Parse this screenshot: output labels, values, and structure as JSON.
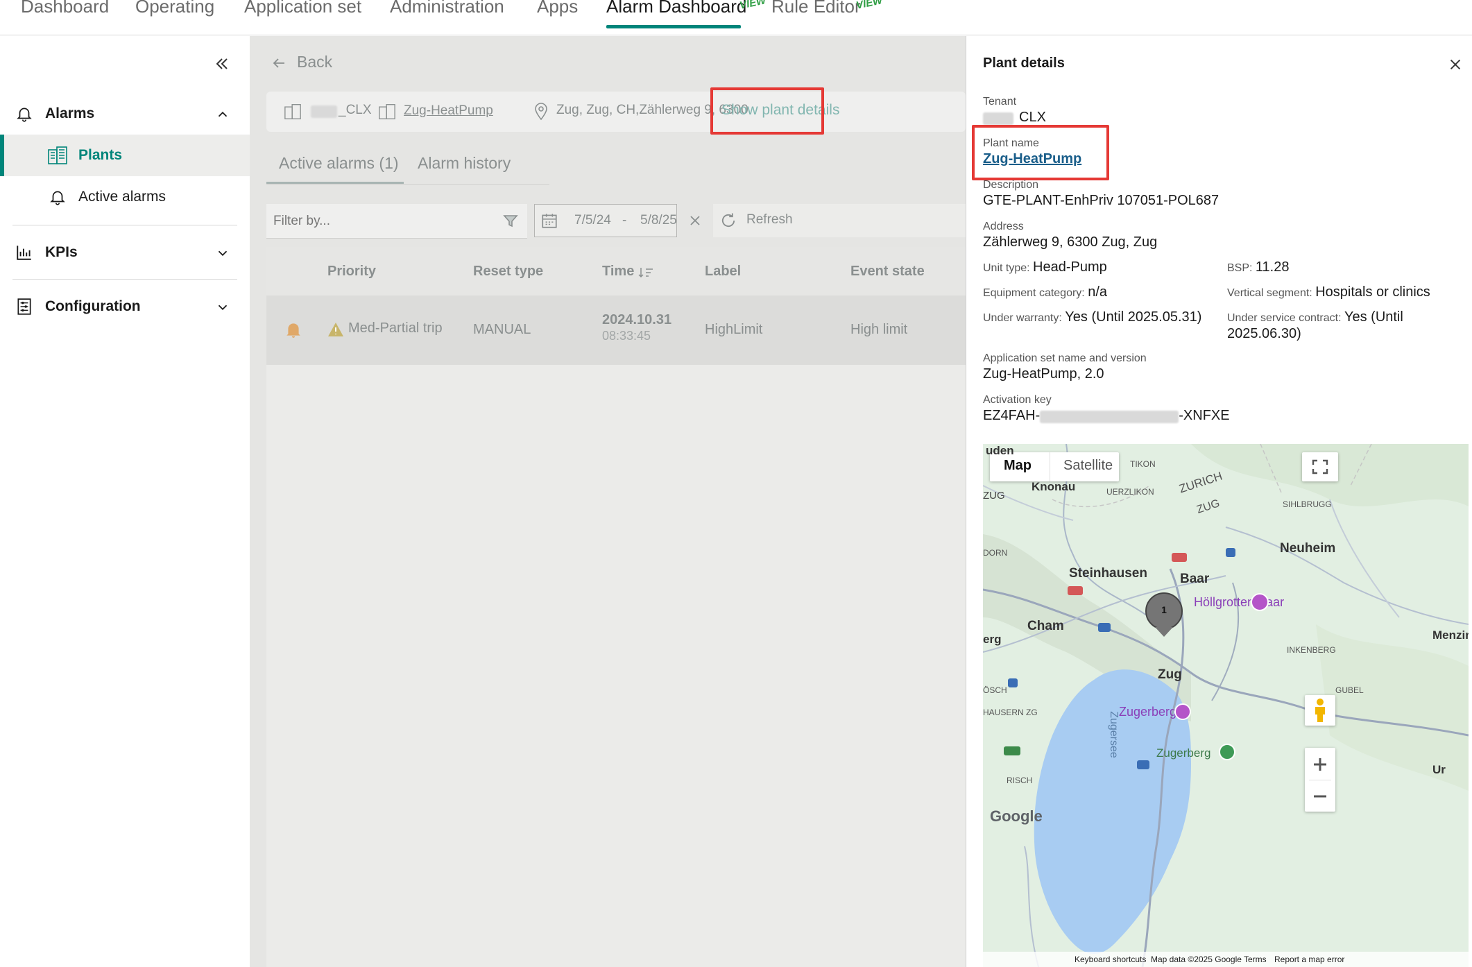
{
  "topnav": {
    "items": [
      "Dashboard",
      "Operating",
      "Application set",
      "Administration",
      "Apps",
      "Alarm Dashboard",
      "Rule Editor"
    ],
    "active": "Alarm Dashboard",
    "preview_tag": "VIEW"
  },
  "sidebar": {
    "alarms_label": "Alarms",
    "plants_label": "Plants",
    "active_alarms_label": "Active alarms",
    "kpis_label": "KPIs",
    "configuration_label": "Configuration"
  },
  "main": {
    "back_label": "Back",
    "crumbs": {
      "tenant_suffix": "_CLX",
      "plant": "Zug-HeatPump",
      "address": "Zug, Zug, CH,Zählerweg 9, 6300",
      "show_details": "Show plant details"
    },
    "tabs": [
      "Active alarms (1)",
      "Alarm history"
    ],
    "filter_placeholder": "Filter by...",
    "date_from": "7/5/24",
    "date_sep": "-",
    "date_to": "5/8/25",
    "refresh_label": "Refresh",
    "table": {
      "headers": [
        "Priority",
        "Reset type",
        "Time",
        "Label",
        "Event state"
      ],
      "row": {
        "priority": "Med-Partial trip",
        "reset_type": "MANUAL",
        "date": "2024.10.31",
        "time": "08:33:45",
        "label": "HighLimit",
        "event_state": "High limit"
      }
    }
  },
  "panel": {
    "title": "Plant details",
    "tenant_label": "Tenant",
    "tenant_value": "CLX",
    "plant_name_label": "Plant name",
    "plant_name": "Zug-HeatPump",
    "description_label": "Description",
    "description": "GTE-PLANT-EnhPriv 107051-POL687",
    "address_label": "Address",
    "address": "Zählerweg 9, 6300 Zug, Zug",
    "unit_type_label": "Unit type:",
    "unit_type": "Head-Pump",
    "bsp_label": "BSP:",
    "bsp": "11.28",
    "equipment_label": "Equipment category:",
    "equipment": "n/a",
    "vertical_label": "Vertical segment:",
    "vertical": "Hospitals or clinics",
    "warranty_label": "Under warranty:",
    "warranty": "Yes (Until 2025.05.31)",
    "service_label": "Under service contract:",
    "service_line1": "Yes (Until",
    "service_line2": "2025.06.30)",
    "appset_label": "Application set name and version",
    "appset": "Zug-HeatPump, 2.0",
    "activation_label": "Activation key",
    "activation_prefix": "EZ4FAH-",
    "activation_suffix": "-XNFXE"
  },
  "map": {
    "tab_map": "Map",
    "tab_satellite": "Satellite",
    "cluster_count": "1",
    "places": {
      "knonau": "Knonau",
      "steinhausen": "Steinhausen",
      "baar": "Baar",
      "cham": "Cham",
      "zug": "Zug",
      "neuheim": "Neuheim",
      "menzingen": "Menzin",
      "zugerberg": "Zugerberg",
      "hoellgrotten": "Höllgrotten Baar",
      "zugersee": "Zugersee",
      "zurich": "ZURICH",
      "zug_region": "ZUG",
      "uerzlikon": "UERZLIKON",
      "sihlbrugg": "SIHLBRUGG",
      "inkenberg": "INKENBERG",
      "gubel": "GUBEL",
      "hausern": "HAUSERN ZG",
      "risch": "RISCH",
      "tikon": "TIKON",
      "dorn": "DORN",
      "osch": "ÖSCH",
      "erg": "erg",
      "uden": "uden",
      "ur": "Ur"
    },
    "footer": {
      "shortcuts": "Keyboard shortcuts",
      "mapdata": "Map data ©2025 Google",
      "terms": "Terms",
      "report": "Report a map error"
    },
    "google_logo": "Google"
  }
}
